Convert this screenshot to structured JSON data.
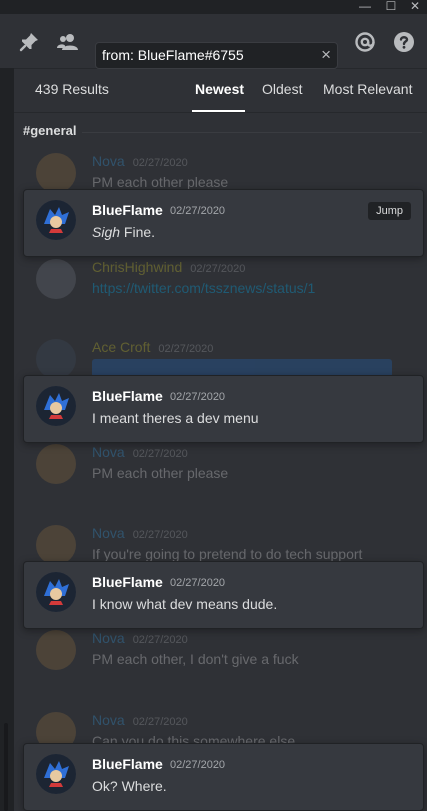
{
  "titlebar": {
    "minimize": "—",
    "maximize": "☐",
    "close": "✕"
  },
  "header": {
    "search_value": "from: BlueFlame#6755",
    "clear_label": "×",
    "icons": [
      "pin-icon",
      "members-icon",
      "mention-icon",
      "help-icon"
    ]
  },
  "search": {
    "results_count": "439 Results",
    "tabs": [
      {
        "label": "Newest",
        "active": true
      },
      {
        "label": "Oldest",
        "active": false
      },
      {
        "label": "Most Relevant",
        "active": false
      }
    ],
    "channel": "#general"
  },
  "context": [
    {
      "user": "Nova",
      "date": "02/27/2020",
      "message": "PM each other please",
      "color": "#3498db"
    },
    {
      "user": "ChrisHighwind",
      "date": "02/27/2020",
      "message": "https://twitter.com/tssznews/status/1",
      "color": "#c9c02b"
    },
    {
      "user": "Ace Croft",
      "date": "02/27/2020",
      "message": "",
      "color": "#c9c02b"
    },
    {
      "user": "Nova",
      "date": "02/27/2020",
      "message": "PM each other please",
      "color": "#3498db"
    },
    {
      "user": "Nova",
      "date": "02/27/2020",
      "message": "If you're going to pretend to do tech support",
      "color": "#3498db"
    },
    {
      "user": "Nova",
      "date": "02/27/2020",
      "message": "PM each other, I don't give a fuck",
      "color": "#3498db"
    },
    {
      "user": "Nova",
      "date": "02/27/2020",
      "message": "Can you do this somewhere else",
      "color": "#3498db"
    }
  ],
  "results": [
    {
      "user": "BlueFlame",
      "date": "02/27/2020",
      "message_em": "Sigh",
      "message": " Fine.",
      "jump": "Jump"
    },
    {
      "user": "BlueFlame",
      "date": "02/27/2020",
      "message_em": "",
      "message": "I meant theres a dev menu",
      "jump": ""
    },
    {
      "user": "BlueFlame",
      "date": "02/27/2020",
      "message_em": "",
      "message": "I know what dev means dude.",
      "jump": ""
    },
    {
      "user": "BlueFlame",
      "date": "02/27/2020",
      "message_em": "",
      "message": "Ok? Where.",
      "jump": ""
    }
  ]
}
